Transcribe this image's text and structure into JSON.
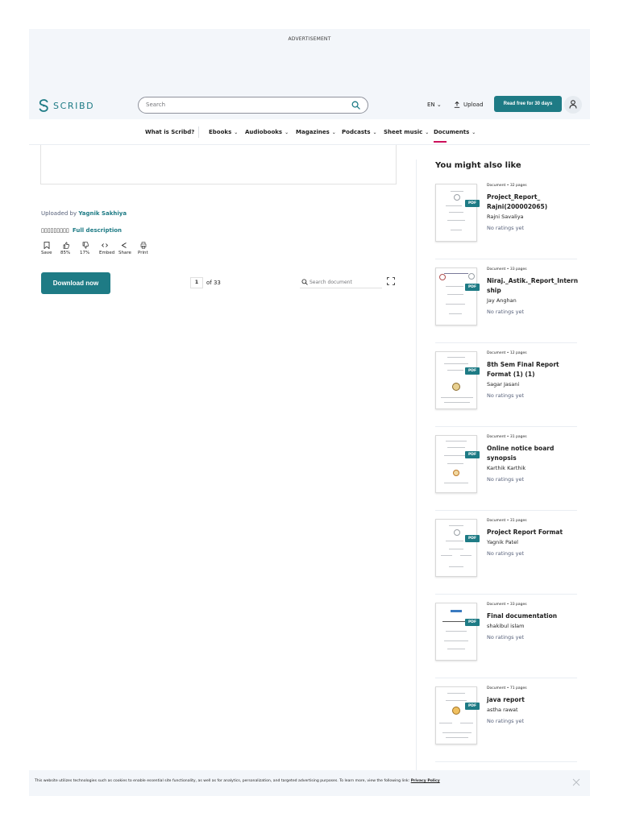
{
  "ad": {
    "label": "ADVERTISEMENT"
  },
  "header": {
    "logo_text": "SCRIBD",
    "search_placeholder": "Search",
    "language": "EN ⌄",
    "upload_label": "Upload",
    "read_free_label": "Read free for 30 days"
  },
  "nav": {
    "items": [
      {
        "label": "What is Scribd?",
        "chevron": ""
      },
      {
        "label": "Ebooks",
        "chevron": "⌄"
      },
      {
        "label": "Audiobooks",
        "chevron": "⌄"
      },
      {
        "label": "Magazines",
        "chevron": "⌄"
      },
      {
        "label": "Podcasts",
        "chevron": "⌄"
      },
      {
        "label": "Sheet music",
        "chevron": "⌄"
      },
      {
        "label": "Documents",
        "chevron": "⌄"
      }
    ],
    "active_color": "#cc0f5b"
  },
  "document": {
    "uploaded_prefix": "Uploaded by",
    "uploader": "Yagnik Sakhiya",
    "description_placeholder": "▯▯▯▯▯▯▯▯▯",
    "full_description_label": "Full description",
    "actions": [
      {
        "icon": "bookmark-icon",
        "label": "Save"
      },
      {
        "icon": "thumbs-up-icon",
        "label": "85%"
      },
      {
        "icon": "thumbs-down-icon",
        "label": "17%"
      },
      {
        "icon": "embed-icon",
        "label": "Embed"
      },
      {
        "icon": "share-icon",
        "label": "Share"
      },
      {
        "icon": "print-icon",
        "label": "Print"
      }
    ],
    "download_label": "Download now",
    "current_page": "1",
    "page_count_label": "of 33",
    "search_placeholder": "Search document"
  },
  "sidebar": {
    "heading": "You might also like",
    "items": [
      {
        "meta": "Document  •  32 pages",
        "title": "Project_Report_ Rajni(200002065)",
        "author": "Rajni Savaliya",
        "rating": "No ratings yet"
      },
      {
        "meta": "Document  •  33 pages",
        "title": "Niraj._Astik._Report_Internship",
        "author": "Jay Anghan",
        "rating": "No ratings yet"
      },
      {
        "meta": "Document  •  12 pages",
        "title": "8th Sem Final Report Format (1) (1)",
        "author": "Sagar Jasani",
        "rating": "No ratings yet"
      },
      {
        "meta": "Document  •  31 pages",
        "title": "Online notice board synopsis",
        "author": "Karthik Karthik",
        "rating": "No ratings yet"
      },
      {
        "meta": "Document  •  31 pages",
        "title": "Project Report Format",
        "author": "Yagnik Patel",
        "rating": "No ratings yet"
      },
      {
        "meta": "Document  •  33 pages",
        "title": "Final documentation",
        "author": "shakibul islam",
        "rating": "No ratings yet"
      },
      {
        "meta": "Document  •  71 pages",
        "title": "java report",
        "author": "astha rawat",
        "rating": "No ratings yet"
      }
    ],
    "pdf_badge": "PDF"
  },
  "cookie": {
    "text": "This website utilizes technologies such as cookies to enable essential site functionality, as well as for analytics, personalization, and targeted advertising purposes. To learn more, view the following link:",
    "link": "Privacy Policy"
  },
  "colors": {
    "brand": "#1e7b85",
    "accent": "#cc0f5b",
    "panel": "#f3f6fa"
  }
}
